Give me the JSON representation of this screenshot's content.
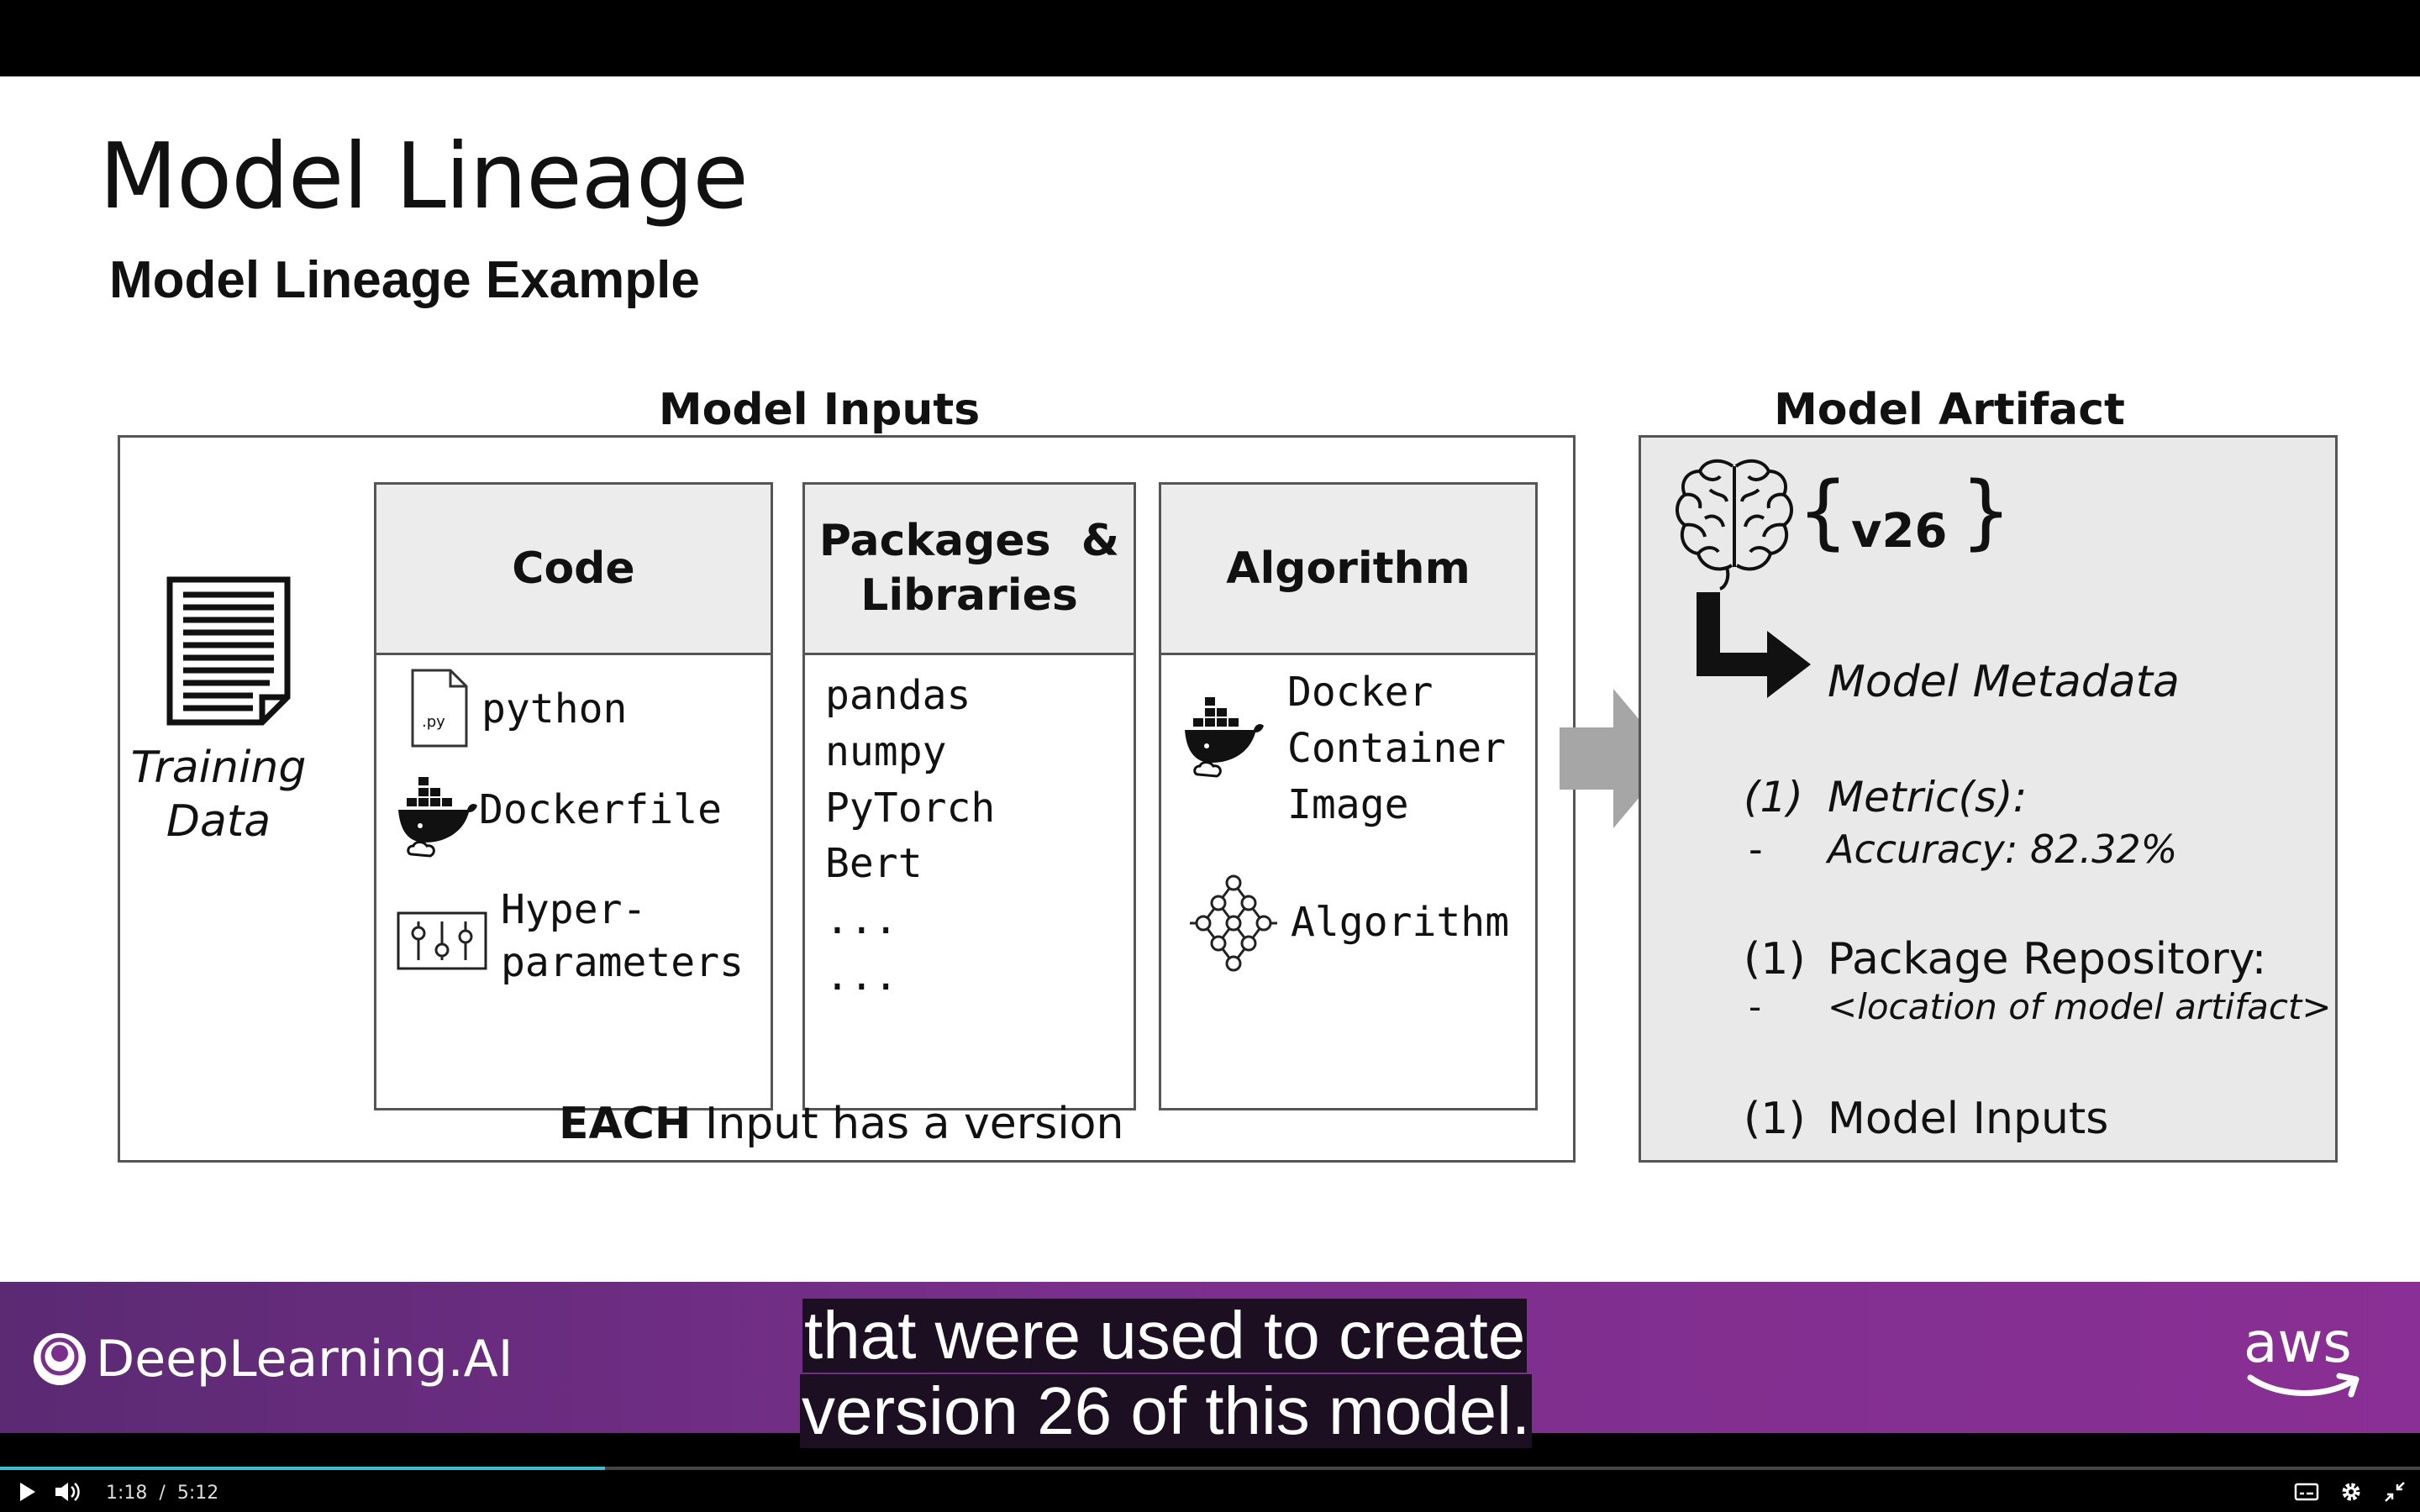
{
  "slide": {
    "title": "Model Lineage",
    "subtitle": "Model Lineage Example",
    "inputs_heading": "Model Inputs",
    "artifact_heading": "Model Artifact",
    "training_data": [
      "Training",
      "Data"
    ],
    "code": {
      "header": "Code",
      "py_badge": ".py",
      "python": "python",
      "dockerfile": "Dockerfile",
      "hyper1": "Hyper-",
      "hyper2": "parameters"
    },
    "packages": {
      "header1": "Packages  &",
      "header2": "Libraries",
      "items": [
        "pandas",
        "numpy",
        "PyTorch",
        "Bert",
        "...",
        "..."
      ]
    },
    "algorithm": {
      "header": "Algorithm",
      "docker1": "Docker",
      "docker2": "Container",
      "docker3": "Image",
      "algo": "Algorithm"
    },
    "footer_bold": "EACH",
    "footer_rest": " Input has a version",
    "artifact": {
      "brace_open": "{",
      "version": "v26",
      "brace_close": "}",
      "metadata": "Model Metadata",
      "n1": "(1)",
      "metrics": "Metric(s):",
      "dash1": "-",
      "accuracy": "Accuracy: 82.32%",
      "n2": "(1)",
      "repo": "Package Repository:",
      "dash2": "-",
      "location": "<location of model artifact>",
      "n3": "(1)",
      "inputs": "Model Inputs"
    }
  },
  "banner": {
    "brand": "DeepLearning.AI",
    "aws": "aws",
    "caption_line1": "that were used to create",
    "caption_line2": "version 26 of this model."
  },
  "player": {
    "time_current": "1:18",
    "time_sep": "/",
    "time_total": "5:12",
    "progress": 0.25
  },
  "colors": {
    "banner": "#7a2f8c",
    "progress": "#2ec5d0",
    "box_fill": "#ececec",
    "arrow": "#a6a6a6"
  }
}
